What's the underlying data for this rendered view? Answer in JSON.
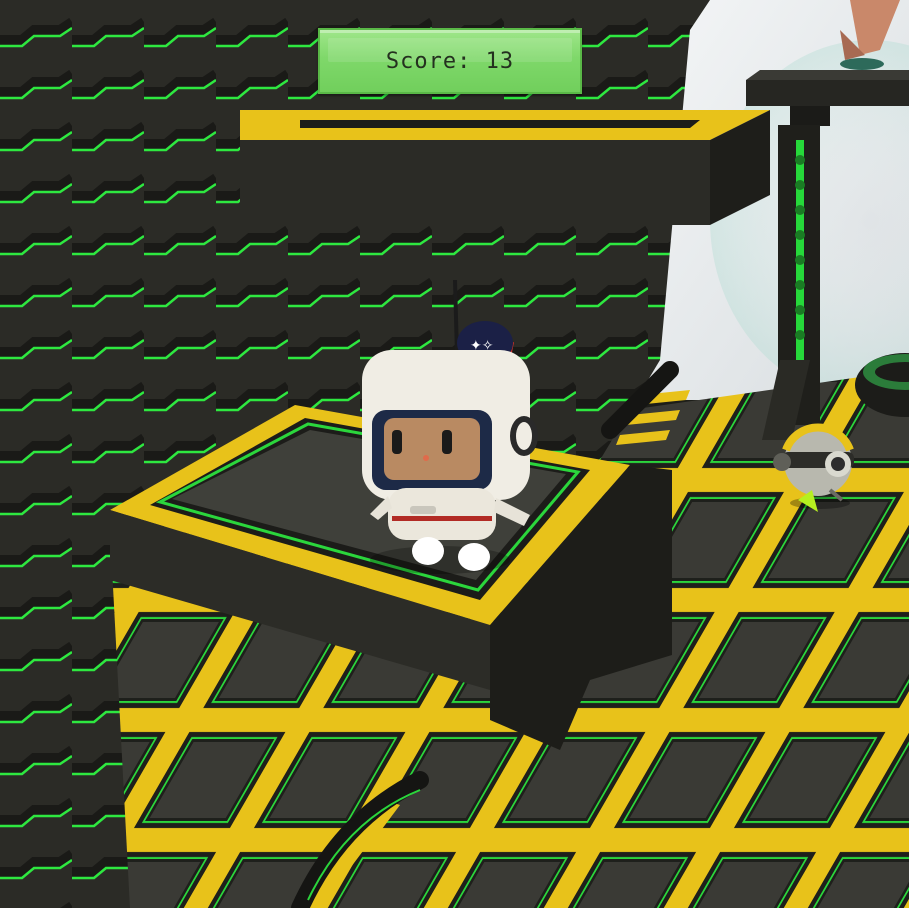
{
  "hud": {
    "score_label": "Score:",
    "score_value": "13"
  },
  "colors": {
    "accent_green": "#27e33a",
    "hazard_yellow": "#e8c21a",
    "wall_dark": "#2b2b26",
    "floor_tile": "#3a3a35",
    "hud_green": "#7fd86a",
    "sky": "#e9ecee"
  },
  "icons": {
    "player": "astronaut-character",
    "enemy": "spherical-robot",
    "pickup": "floating-crystal"
  }
}
